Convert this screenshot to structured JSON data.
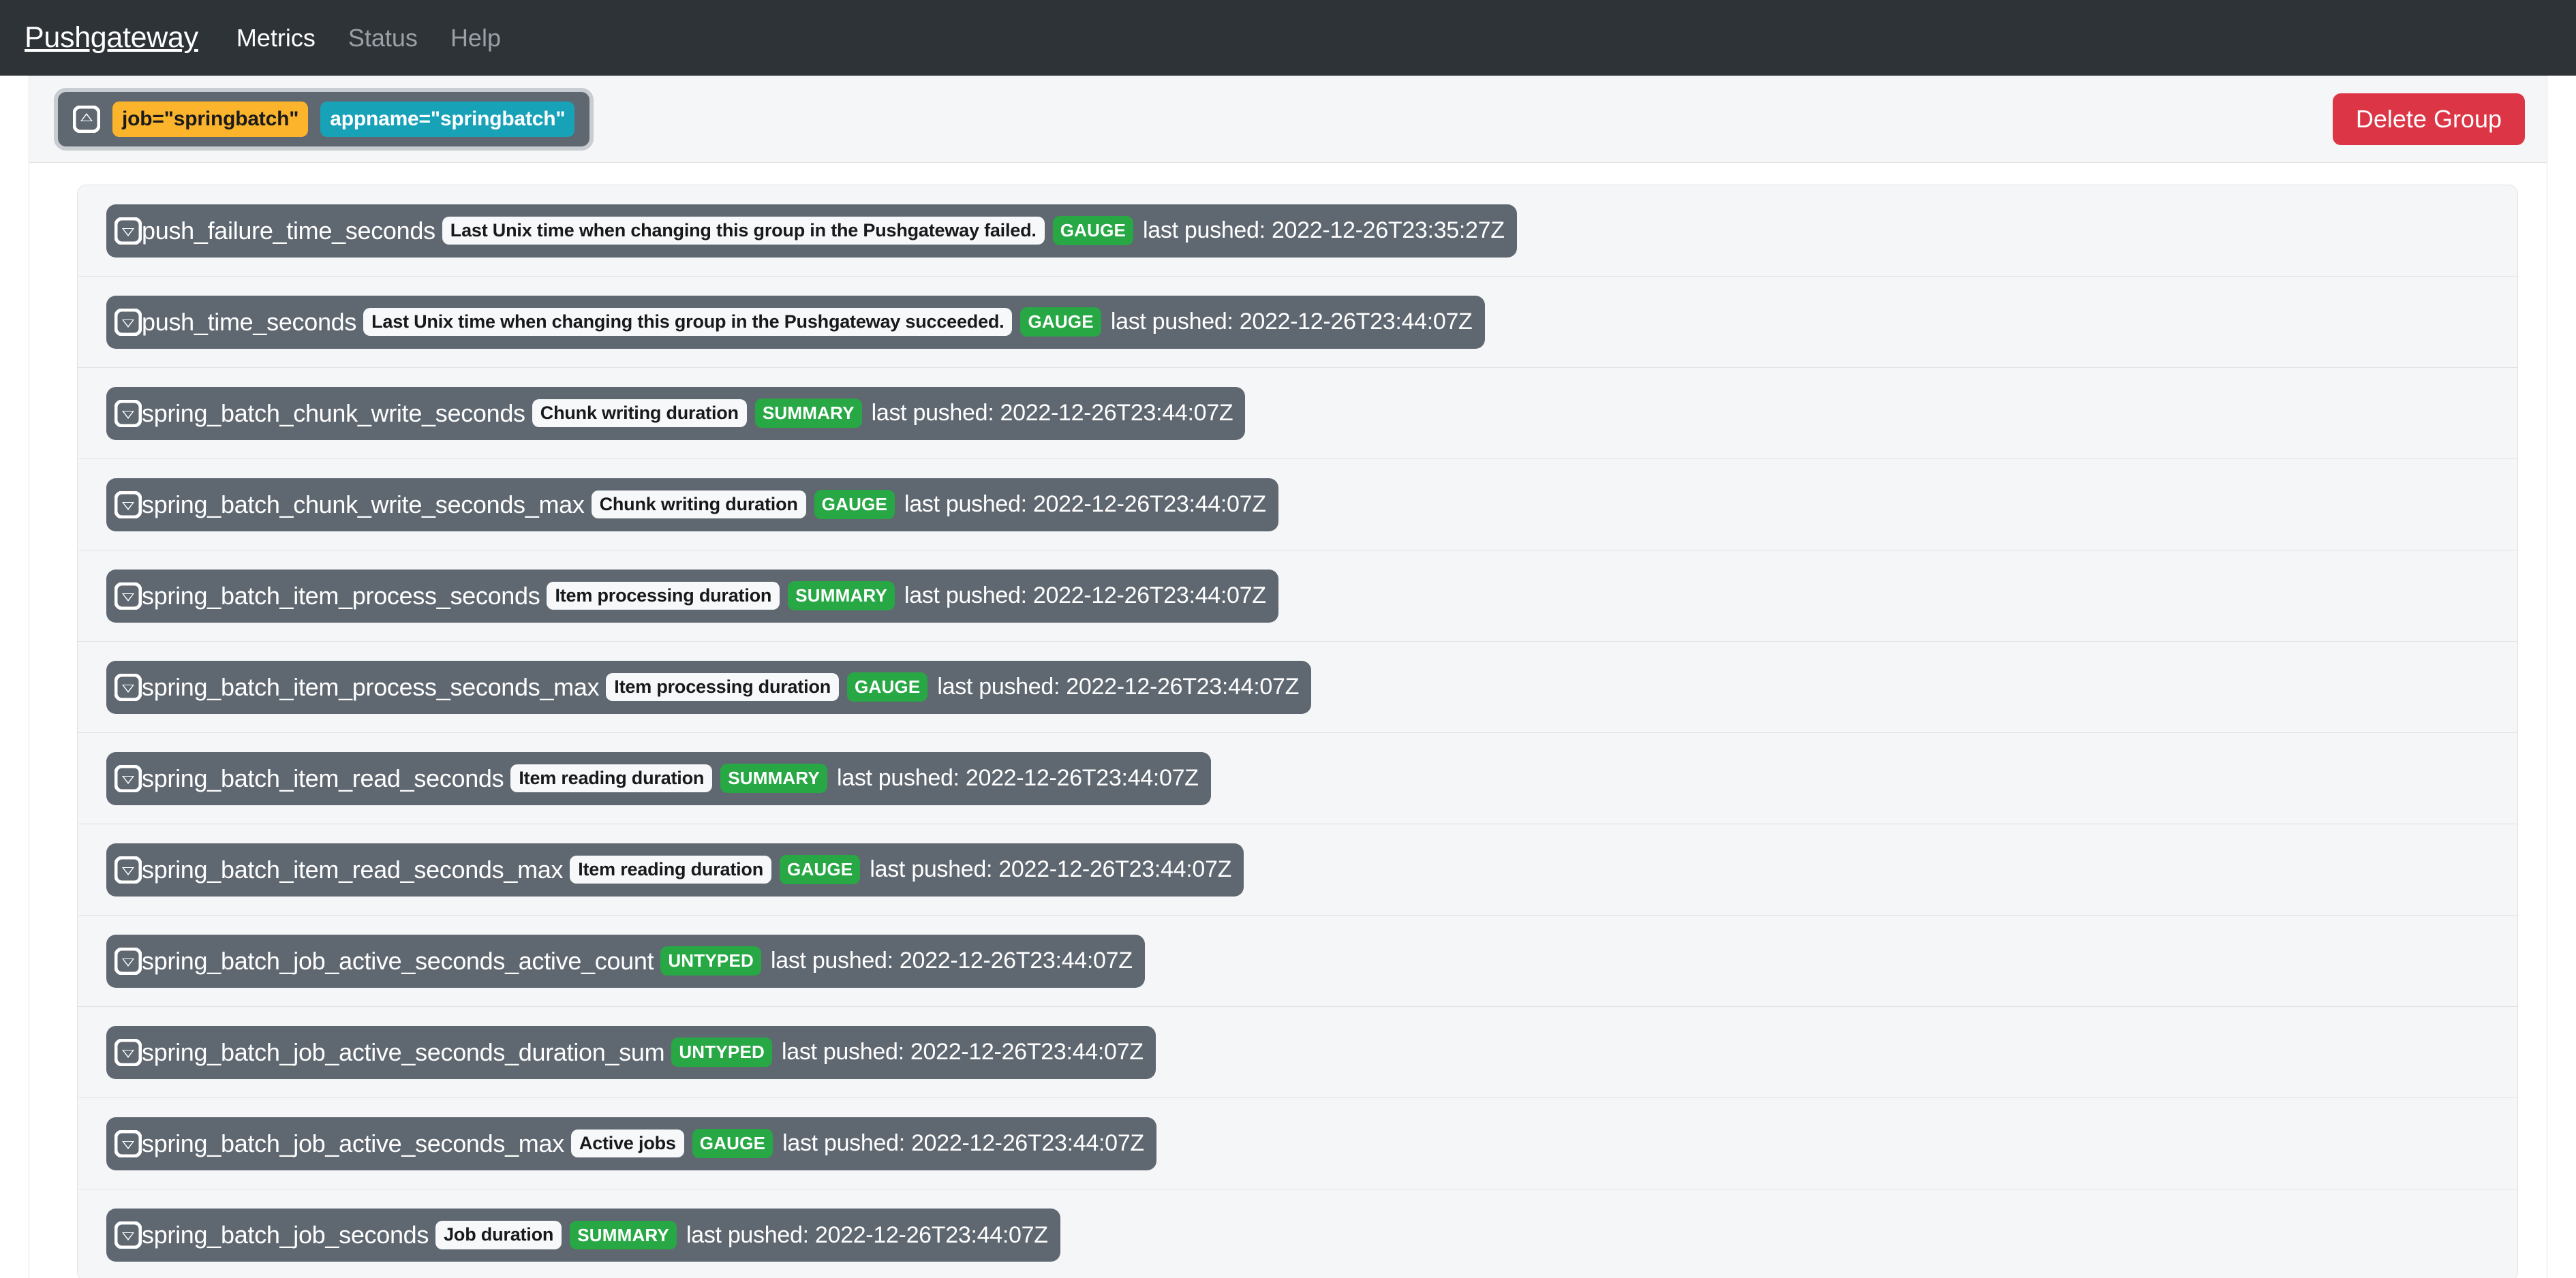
{
  "navbar": {
    "brand": "Pushgateway",
    "links": [
      {
        "label": "Metrics",
        "active": true
      },
      {
        "label": "Status",
        "active": false
      },
      {
        "label": "Help",
        "active": false
      }
    ]
  },
  "colors": {
    "navbar_bg": "#2e3338",
    "pill_bg": "#5f6771",
    "job_badge": "#fcb42d",
    "appname_badge": "#18a2b8",
    "type_badge": "#28a745",
    "delete_button": "#dc3545",
    "row_bg": "#f5f6f7"
  },
  "group": {
    "collapse_icon": "collapse-up-icon",
    "labels": [
      {
        "text": "job=\"springbatch\"",
        "kind": "job"
      },
      {
        "text": "appname=\"springbatch\"",
        "kind": "appname"
      }
    ],
    "delete_label": "Delete Group"
  },
  "metrics": [
    {
      "collapse_icon": "collapse-down-icon",
      "name": "push_failure_time_seconds",
      "help": "Last Unix time when changing this group in the Pushgateway failed.",
      "type": "GAUGE",
      "pushed": "last pushed: 2022-12-26T23:35:27Z"
    },
    {
      "collapse_icon": "collapse-down-icon",
      "name": "push_time_seconds",
      "help": "Last Unix time when changing this group in the Pushgateway succeeded.",
      "type": "GAUGE",
      "pushed": "last pushed: 2022-12-26T23:44:07Z"
    },
    {
      "collapse_icon": "collapse-down-icon",
      "name": "spring_batch_chunk_write_seconds",
      "help": "Chunk writing duration",
      "type": "SUMMARY",
      "pushed": "last pushed: 2022-12-26T23:44:07Z"
    },
    {
      "collapse_icon": "collapse-down-icon",
      "name": "spring_batch_chunk_write_seconds_max",
      "help": "Chunk writing duration",
      "type": "GAUGE",
      "pushed": "last pushed: 2022-12-26T23:44:07Z"
    },
    {
      "collapse_icon": "collapse-down-icon",
      "name": "spring_batch_item_process_seconds",
      "help": "Item processing duration",
      "type": "SUMMARY",
      "pushed": "last pushed: 2022-12-26T23:44:07Z"
    },
    {
      "collapse_icon": "collapse-down-icon",
      "name": "spring_batch_item_process_seconds_max",
      "help": "Item processing duration",
      "type": "GAUGE",
      "pushed": "last pushed: 2022-12-26T23:44:07Z"
    },
    {
      "collapse_icon": "collapse-down-icon",
      "name": "spring_batch_item_read_seconds",
      "help": "Item reading duration",
      "type": "SUMMARY",
      "pushed": "last pushed: 2022-12-26T23:44:07Z"
    },
    {
      "collapse_icon": "collapse-down-icon",
      "name": "spring_batch_item_read_seconds_max",
      "help": "Item reading duration",
      "type": "GAUGE",
      "pushed": "last pushed: 2022-12-26T23:44:07Z"
    },
    {
      "collapse_icon": "collapse-down-icon",
      "name": "spring_batch_job_active_seconds_active_count",
      "help": "",
      "type": "UNTYPED",
      "pushed": "last pushed: 2022-12-26T23:44:07Z"
    },
    {
      "collapse_icon": "collapse-down-icon",
      "name": "spring_batch_job_active_seconds_duration_sum",
      "help": "",
      "type": "UNTYPED",
      "pushed": "last pushed: 2022-12-26T23:44:07Z"
    },
    {
      "collapse_icon": "collapse-down-icon",
      "name": "spring_batch_job_active_seconds_max",
      "help": "Active jobs",
      "type": "GAUGE",
      "pushed": "last pushed: 2022-12-26T23:44:07Z"
    },
    {
      "collapse_icon": "collapse-down-icon",
      "name": "spring_batch_job_seconds",
      "help": "Job duration",
      "type": "SUMMARY",
      "pushed": "last pushed: 2022-12-26T23:44:07Z"
    }
  ]
}
